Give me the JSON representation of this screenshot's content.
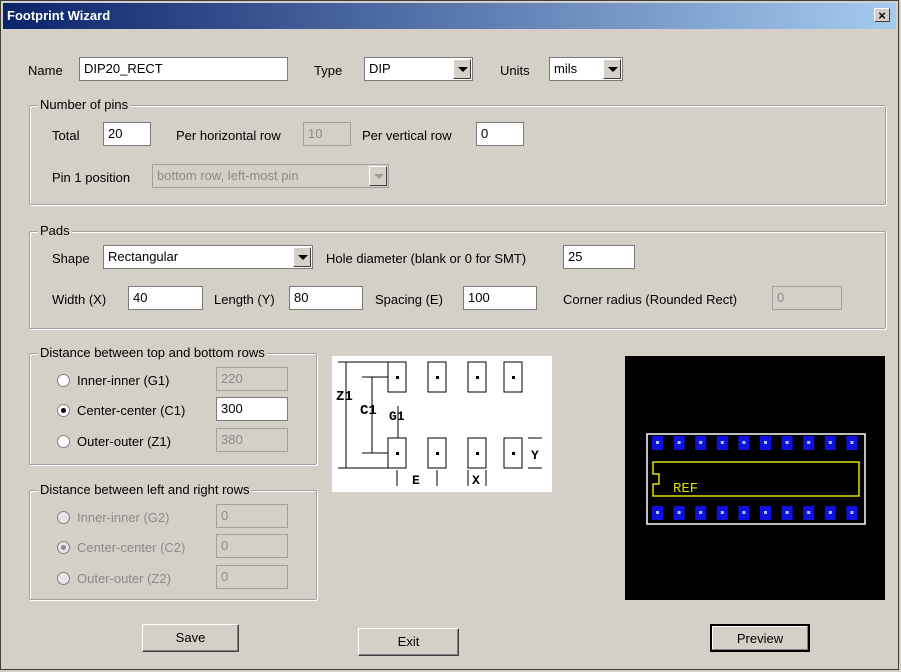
{
  "window": {
    "title": "Footprint Wizard",
    "close_glyph": "×"
  },
  "top": {
    "name_label": "Name",
    "name_value": "DIP20_RECT",
    "type_label": "Type",
    "type_value": "DIP",
    "units_label": "Units",
    "units_value": "mils"
  },
  "pins": {
    "legend": "Number of pins",
    "total_label": "Total",
    "total_value": "20",
    "per_h_label": "Per horizontal row",
    "per_h_value": "10",
    "per_v_label": "Per vertical row",
    "per_v_value": "0",
    "pin1_label": "Pin 1 position",
    "pin1_value": "bottom row, left-most pin"
  },
  "pads": {
    "legend": "Pads",
    "shape_label": "Shape",
    "shape_value": "Rectangular",
    "hole_label": "Hole diameter (blank or 0 for SMT)",
    "hole_value": "25",
    "width_label": "Width (X)",
    "width_value": "40",
    "length_label": "Length (Y)",
    "length_value": "80",
    "spacing_label": "Spacing (E)",
    "spacing_value": "100",
    "corner_label": "Corner radius (Rounded Rect)",
    "corner_value": "0"
  },
  "tb_rows": {
    "legend": "Distance between top and bottom rows",
    "inner_label": "Inner-inner (G1)",
    "inner_value": "220",
    "center_label": "Center-center (C1)",
    "center_value": "300",
    "outer_label": "Outer-outer (Z1)",
    "outer_value": "380"
  },
  "lr_rows": {
    "legend": "Distance between left and right rows",
    "inner_label": "Inner-inner (G2)",
    "inner_value": "0",
    "center_label": "Center-center (C2)",
    "center_value": "0",
    "outer_label": "Outer-outer (Z2)",
    "outer_value": "0"
  },
  "diagram_labels": {
    "z1": "Z1",
    "c1": "C1",
    "g1": "G1",
    "e": "E",
    "x": "X",
    "y": "Y"
  },
  "preview": {
    "ref": "REF",
    "pad_color": "#1010e0",
    "outline_color": "#e0e000",
    "board_outline": "#ffffff"
  },
  "buttons": {
    "save": "Save",
    "exit": "Exit",
    "preview": "Preview"
  }
}
